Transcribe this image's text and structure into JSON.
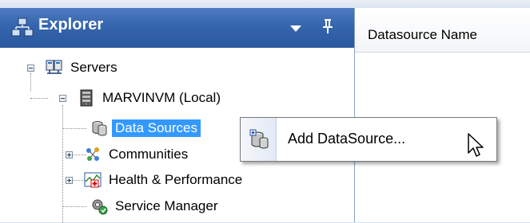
{
  "explorer": {
    "title": "Explorer",
    "header_icon": "servers-network-icon",
    "dropdown_icon": "dropdown-arrow-icon",
    "pin_icon": "pin-icon"
  },
  "tree": {
    "servers": {
      "label": "Servers",
      "icon": "servers-group-icon",
      "expanded": true
    },
    "server": {
      "label": "MARVINVM (Local)",
      "icon": "server-icon",
      "expanded": true
    },
    "children": [
      {
        "label": "Data Sources",
        "icon": "datasource-icon",
        "selected": true
      },
      {
        "label": "Communities",
        "icon": "communities-icon",
        "expandable": true
      },
      {
        "label": "Health & Performance",
        "icon": "health-icon",
        "expandable": true
      },
      {
        "label": "Service Manager",
        "icon": "service-manager-icon"
      }
    ]
  },
  "list_view": {
    "columns": [
      "Datasource Name"
    ]
  },
  "context_menu": {
    "items": [
      {
        "label": "Add DataSource...",
        "icon": "add-datasource-icon"
      }
    ]
  },
  "colors": {
    "header_blue": "#2b589f",
    "selection_blue": "#3399ff"
  }
}
